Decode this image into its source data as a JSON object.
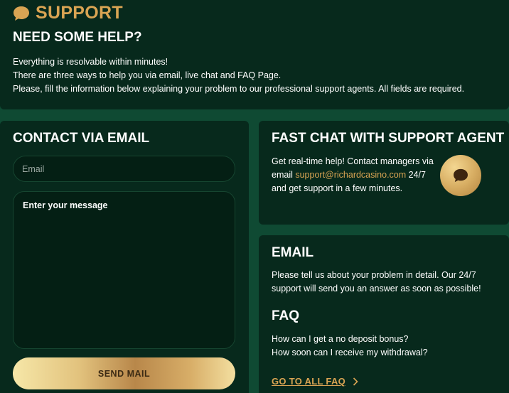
{
  "header": {
    "icon": "chat-bubble-icon",
    "title": "SUPPORT",
    "subtitle": "NEED SOME HELP?",
    "intro": [
      "Everything is resolvable within minutes!",
      "There are three ways to help you via email, live chat and FAQ Page.",
      "Please, fill the information below explaining your problem to our professional support agents. All fields are required."
    ]
  },
  "contact": {
    "title": "CONTACT VIA EMAIL",
    "email_placeholder": "Email",
    "message_placeholder": "Enter your message",
    "send_label": "SEND MAIL"
  },
  "chat": {
    "title": "FAST CHAT WITH SUPPORT AGENT",
    "text_before": "Get real-time help! Contact managers via email ",
    "email": "support@richardcasino.com",
    "text_after": " 24/7 and get support in a few minutes.",
    "icon": "chat-bubble-icon"
  },
  "email_section": {
    "title": "EMAIL",
    "text": "Please tell us about your problem in detail. Our 24/7 support will send you an answer as soon as possible!"
  },
  "faq": {
    "title": "FAQ",
    "questions": [
      "How can I get a no deposit bonus?",
      "How soon can I receive my withdrawal?"
    ],
    "link_label": "GO TO ALL FAQ",
    "link_icon": "chevron-right-icon"
  },
  "colors": {
    "background": "#0f4a33",
    "panel": "#07291c",
    "accent_gold": "#d9a453"
  }
}
